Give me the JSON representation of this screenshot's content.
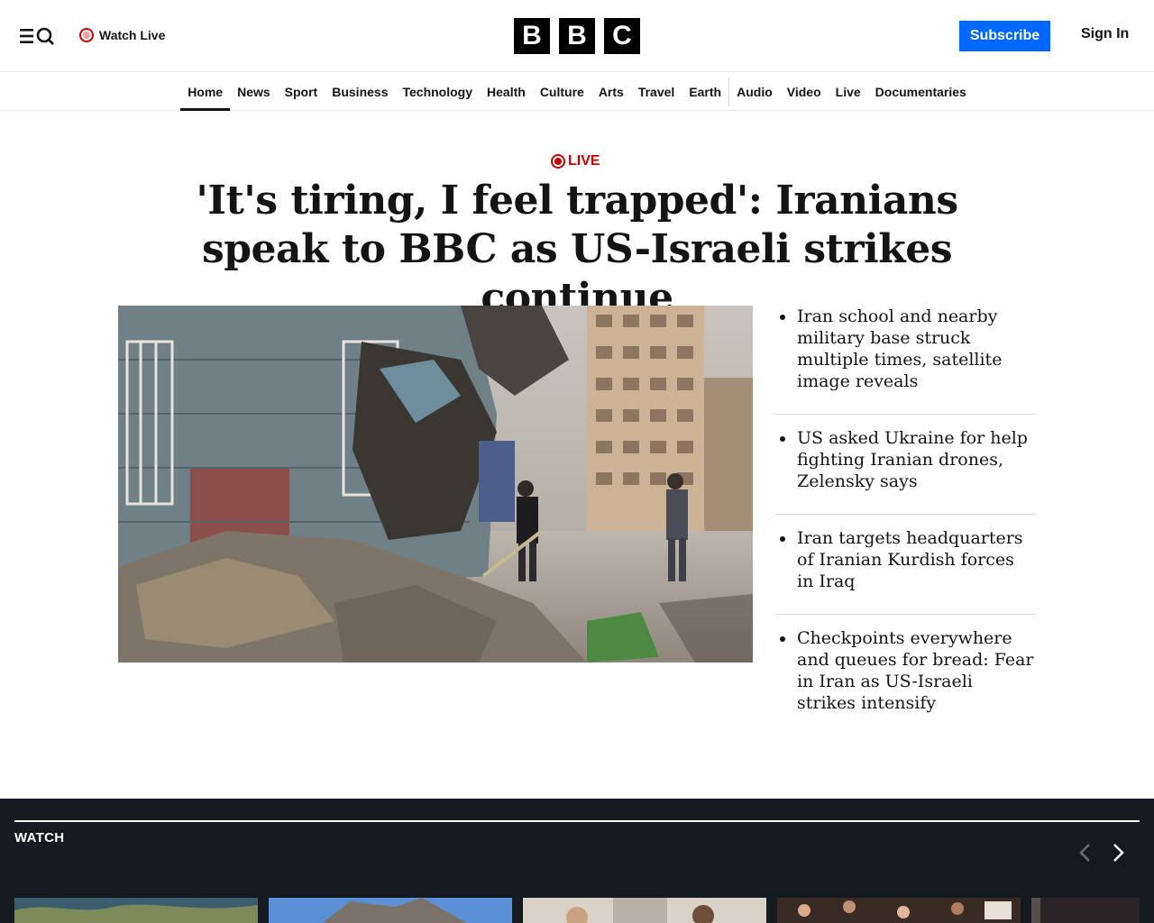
{
  "header": {
    "watch_live": "Watch Live",
    "logo_letters": [
      "B",
      "B",
      "C"
    ],
    "subscribe": "Subscribe",
    "sign_in": "Sign In"
  },
  "nav": {
    "items": [
      "Home",
      "News",
      "Sport",
      "Business",
      "Technology",
      "Health",
      "Culture",
      "Arts",
      "Travel",
      "Earth",
      "Audio",
      "Video",
      "Live",
      "Documentaries"
    ],
    "active": "Home"
  },
  "lead": {
    "live_label": "LIVE",
    "headline": "'It's tiring, I feel trapped': Iranians speak to BBC as US-Israeli strikes continue"
  },
  "related": [
    "Iran school and nearby military base struck multiple times, satellite image reveals",
    "US asked Ukraine for help fighting Iranian drones, Zelensky says",
    "Iran targets headquarters of Iranian Kurdish forces in Iraq",
    "Checkpoints everywhere and queues for bread: Fear in Iran as US-Israeli strikes intensify"
  ],
  "watch": {
    "title": "WATCH"
  },
  "colors": {
    "brand_blue": "#0068ff",
    "live_red": "#cc0000",
    "watch_bg": "#141a20"
  }
}
